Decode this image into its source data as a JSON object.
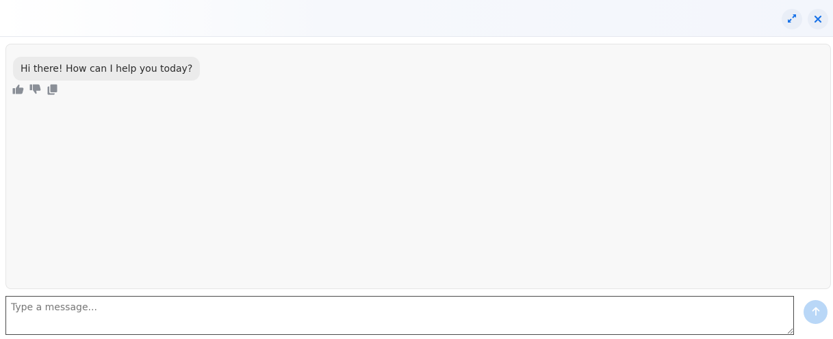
{
  "header": {
    "expand_icon": "expand-icon",
    "close_icon": "close-icon"
  },
  "chat": {
    "messages": [
      {
        "role": "assistant",
        "text": "Hi there! How can I help you today?",
        "actions": [
          "thumbs-up-icon",
          "thumbs-down-icon",
          "copy-icon"
        ]
      }
    ]
  },
  "composer": {
    "placeholder": "Type a message...",
    "value": "",
    "send_icon": "arrow-up-icon"
  },
  "colors": {
    "accent": "#1a73e8",
    "send_button_bg": "#b9d7f7",
    "bubble_bg": "#ebebeb",
    "icon_gray": "#8a8f97"
  }
}
